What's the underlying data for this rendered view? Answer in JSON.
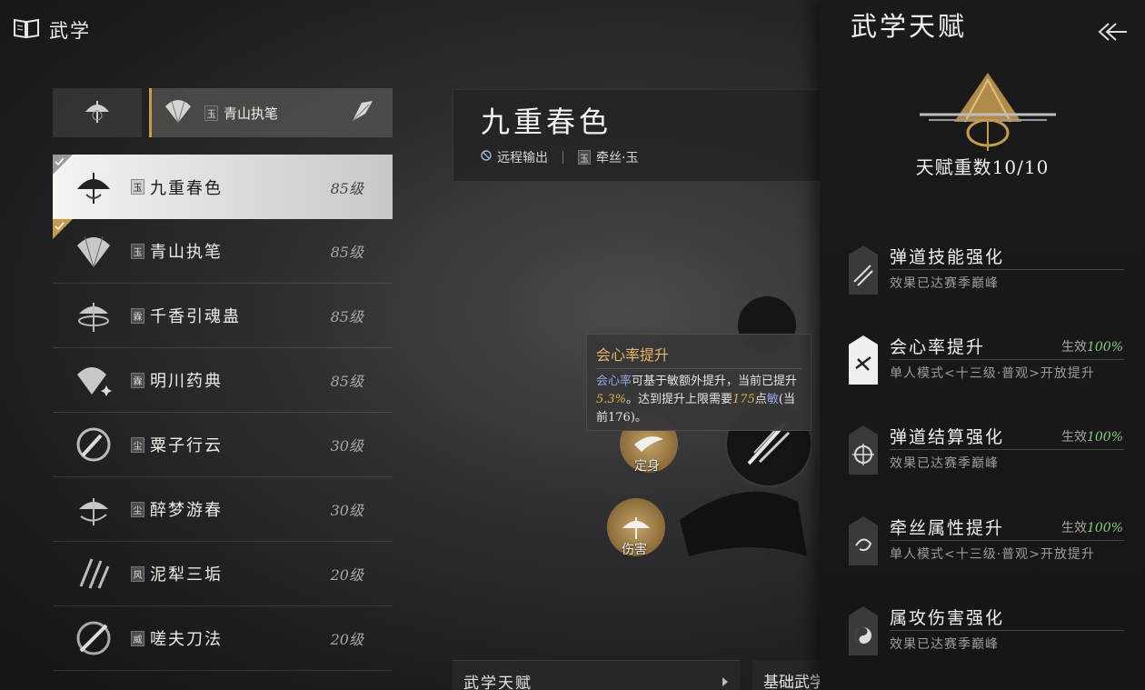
{
  "header": {
    "title": "武学",
    "icon": "book-icon"
  },
  "set_bar": {
    "active_label": "青山执笔",
    "active_tag": "玉"
  },
  "skills": [
    {
      "name": "九重春色",
      "tag": "玉",
      "level": "85级",
      "selected": true,
      "checked": true
    },
    {
      "name": "青山执笔",
      "tag": "玉",
      "level": "85级",
      "selected": false,
      "checked": true
    },
    {
      "name": "千香引魂蛊",
      "tag": "霖",
      "level": "85级",
      "selected": false,
      "checked": false
    },
    {
      "name": "明川药典",
      "tag": "霖",
      "level": "85级",
      "selected": false,
      "checked": false
    },
    {
      "name": "粟子行云",
      "tag": "尘",
      "level": "30级",
      "selected": false,
      "checked": false
    },
    {
      "name": "醉梦游春",
      "tag": "尘",
      "level": "30级",
      "selected": false,
      "checked": false
    },
    {
      "name": "泥犁三垢",
      "tag": "风",
      "level": "20级",
      "selected": false,
      "checked": false
    },
    {
      "name": "嗟夫刀法",
      "tag": "威",
      "level": "20级",
      "selected": false,
      "checked": false
    }
  ],
  "detail": {
    "title": "九重春色",
    "role": "远程输出",
    "path_tag": "玉",
    "path": "牵丝·玉"
  },
  "tooltip": {
    "title": "会心率提升",
    "seg1": "会心率",
    "seg2": "可基于敏额外提升，当前已提升",
    "seg3": "5.3%",
    "seg4": "。达到提升上限需要",
    "seg5": "175",
    "seg6": "点",
    "seg7": "敏",
    "seg8": "(当前176)。"
  },
  "tree": {
    "node1_label": "定身",
    "node2_label": "伤害"
  },
  "tabs": {
    "tab1": "武学天赋",
    "tab2": "基础武学"
  },
  "talent_panel": {
    "title": "武学天赋",
    "count": "天赋重数10/10",
    "talents": [
      {
        "name": "弹道技能强化",
        "effect_prefix": "",
        "effect_value": "",
        "desc": "效果已达赛季巅峰"
      },
      {
        "name": "会心率提升",
        "effect_prefix": "生效",
        "effect_value": "100%",
        "desc": "单人模式<十三级·普观>开放提升"
      },
      {
        "name": "弹道结算强化",
        "effect_prefix": "生效",
        "effect_value": "100%",
        "desc": "效果已达赛季巅峰"
      },
      {
        "name": "牵丝属性提升",
        "effect_prefix": "生效",
        "effect_value": "100%",
        "desc": "单人模式<十三级·普观>开放提升"
      },
      {
        "name": "属攻伤害强化",
        "effect_prefix": "",
        "effect_value": "",
        "desc": "效果已达赛季巅峰"
      }
    ]
  },
  "colors": {
    "accent_gold": "#c89a4c",
    "effect_green": "#7fcf78",
    "tooltip_title": "#e8b46a"
  }
}
